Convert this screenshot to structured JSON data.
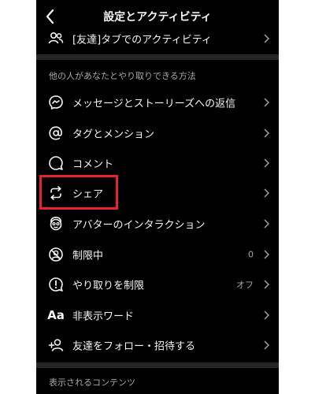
{
  "header": {
    "title": "設定とアクティビティ"
  },
  "top_item": {
    "label": "[友達]タブでのアクティビティ",
    "icon": "people-icon"
  },
  "section1": {
    "title": "他の人があなたとやり取りできる方法"
  },
  "items": [
    {
      "label": "メッセージとストーリーズへの返信",
      "icon": "messenger-icon",
      "value": ""
    },
    {
      "label": "タグとメンション",
      "icon": "at-sign-icon",
      "value": ""
    },
    {
      "label": "コメント",
      "icon": "comment-icon",
      "value": ""
    },
    {
      "label": "シェア",
      "icon": "share-repost-icon",
      "value": ""
    },
    {
      "label": "アバターのインタラクション",
      "icon": "avatar-icon",
      "value": ""
    },
    {
      "label": "制限中",
      "icon": "restricted-icon",
      "value": "0"
    },
    {
      "label": "やり取りを制限",
      "icon": "limit-interactions-icon",
      "value": "オフ"
    },
    {
      "label": "非表示ワード",
      "icon": "hidden-words-icon",
      "value": "",
      "glyph": "Aa"
    },
    {
      "label": "友達をフォロー・招待する",
      "icon": "add-person-icon",
      "value": ""
    }
  ],
  "section2": {
    "title": "表示されるコンテンツ"
  },
  "colors": {
    "background": "#000000",
    "text": "#f5f5f5",
    "secondary": "#a8a8a8",
    "divider": "#262626",
    "highlight": "#e8242b"
  }
}
